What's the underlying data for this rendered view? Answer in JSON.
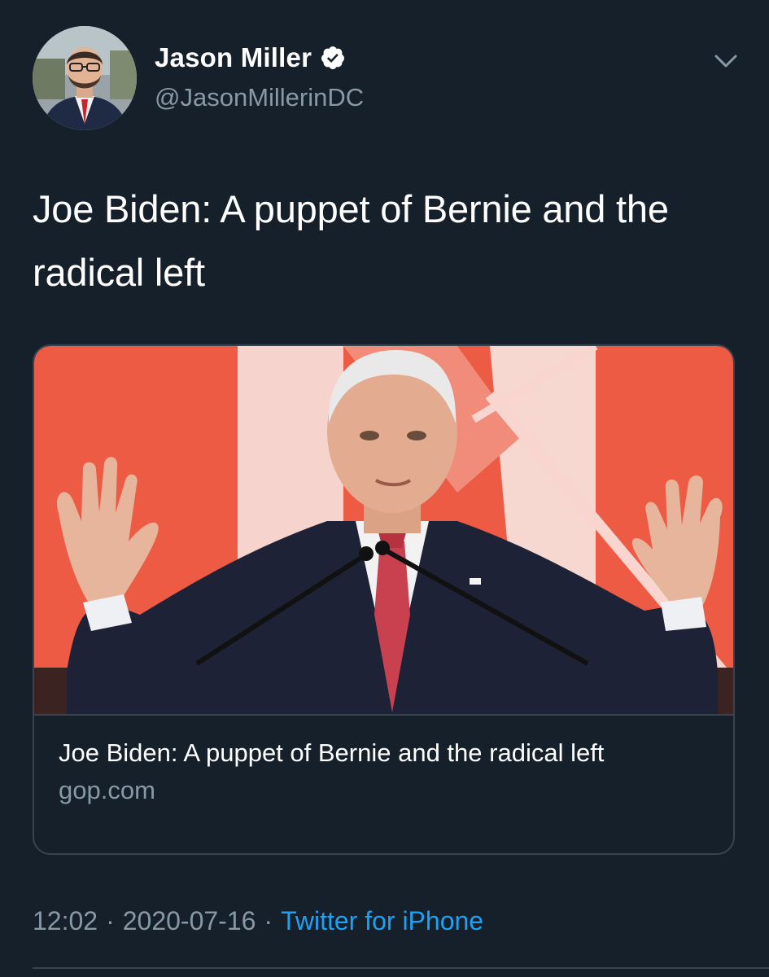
{
  "author": {
    "name": "Jason Miller",
    "handle": "@JasonMillerinDC",
    "verified": true,
    "avatar_icon": "profile-photo"
  },
  "tweet": {
    "text": "Joe Biden: A puppet of Bernie and the radical left"
  },
  "card": {
    "title": "Joe Biden: A puppet of Bernie and the radical left",
    "domain": "gop.com",
    "image_icon": "speaker-at-podium-photo"
  },
  "meta": {
    "time": "12:02",
    "separator": "·",
    "date": "2020-07-16",
    "source": "Twitter for iPhone"
  },
  "colors": {
    "background": "#15202b",
    "text_primary": "#ffffff",
    "text_secondary": "#8899a6",
    "link": "#1da1f2",
    "border": "#38444d",
    "card_image_bg": "#ef5c45"
  }
}
